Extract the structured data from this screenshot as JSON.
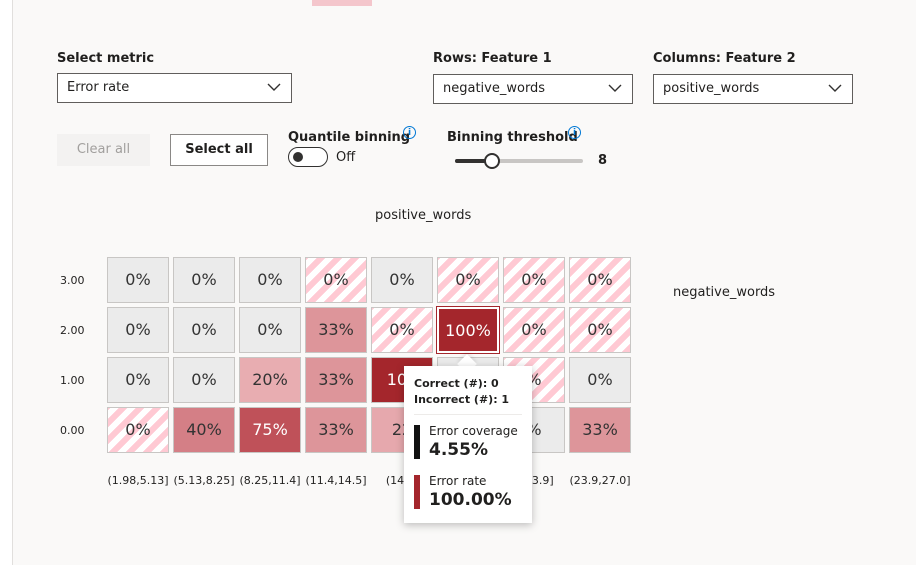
{
  "controls": {
    "select_metric_label": "Select metric",
    "select_metric_value": "Error rate",
    "rows_label": "Rows: Feature 1",
    "rows_value": "negative_words",
    "columns_label": "Columns: Feature 2",
    "columns_value": "positive_words",
    "clear_all": "Clear all",
    "select_all": "Select all",
    "quantile_binning_label": "Quantile binning",
    "quantile_binning_state": "Off",
    "binning_threshold_label": "Binning threshold",
    "binning_threshold_value": "8",
    "binning_threshold_fraction": 0.29,
    "info_glyph": "i"
  },
  "heatmap": {
    "column_feature": "positive_words",
    "row_feature": "negative_words",
    "row_labels": [
      "3.00",
      "2.00",
      "1.00",
      "0.00"
    ],
    "column_labels": [
      "(1.98,5.13]",
      "(5.13,8.25]",
      "(8.25,11.4]",
      "(11.4,14.5]",
      "(14.5,",
      "",
      "8,23.9]",
      "(23.9,27.0]"
    ],
    "cells": [
      [
        {
          "t": "0%",
          "s": "gray"
        },
        {
          "t": "0%",
          "s": "gray"
        },
        {
          "t": "0%",
          "s": "gray"
        },
        {
          "t": "0%",
          "s": "hatch"
        },
        {
          "t": "0%",
          "s": "gray"
        },
        {
          "t": "0%",
          "s": "hatch"
        },
        {
          "t": "0%",
          "s": "hatch"
        },
        {
          "t": "0%",
          "s": "hatch"
        }
      ],
      [
        {
          "t": "0%",
          "s": "gray"
        },
        {
          "t": "0%",
          "s": "gray"
        },
        {
          "t": "0%",
          "s": "gray"
        },
        {
          "t": "33%",
          "s": "r33"
        },
        {
          "t": "0%",
          "s": "hatch"
        },
        {
          "t": "100%",
          "s": "r100",
          "sel": true
        },
        {
          "t": "0%",
          "s": "hatch"
        },
        {
          "t": "0%",
          "s": "hatch"
        }
      ],
      [
        {
          "t": "0%",
          "s": "gray"
        },
        {
          "t": "0%",
          "s": "gray"
        },
        {
          "t": "20%",
          "s": "r20"
        },
        {
          "t": "33%",
          "s": "r33"
        },
        {
          "t": "100",
          "s": "r100"
        },
        {
          "t": "",
          "s": "gray"
        },
        {
          "t": "%",
          "s": "hatch"
        },
        {
          "t": "0%",
          "s": "gray"
        }
      ],
      [
        {
          "t": "0%",
          "s": "hatch"
        },
        {
          "t": "40%",
          "s": "r40"
        },
        {
          "t": "75%",
          "s": "r75"
        },
        {
          "t": "33%",
          "s": "r33"
        },
        {
          "t": "22",
          "s": "r22"
        },
        {
          "t": "",
          "s": "gray"
        },
        {
          "t": "%",
          "s": "gray"
        },
        {
          "t": "33%",
          "s": "r33"
        }
      ]
    ],
    "colors": {
      "gray": "#ebebeb",
      "r20": "#e8adb1",
      "r22": "#e6a8ad",
      "r33": "#dd959a",
      "r40": "#d47f86",
      "r75": "#bf5159",
      "r100": "#a4262c"
    }
  },
  "tooltip": {
    "correct": "Correct (#): 0",
    "incorrect": "Incorrect (#): 1",
    "metrics": [
      {
        "label": "Error coverage",
        "value": "4.55%",
        "color": "#111111"
      },
      {
        "label": "Error rate",
        "value": "100.00%",
        "color": "#a4262c"
      }
    ]
  }
}
